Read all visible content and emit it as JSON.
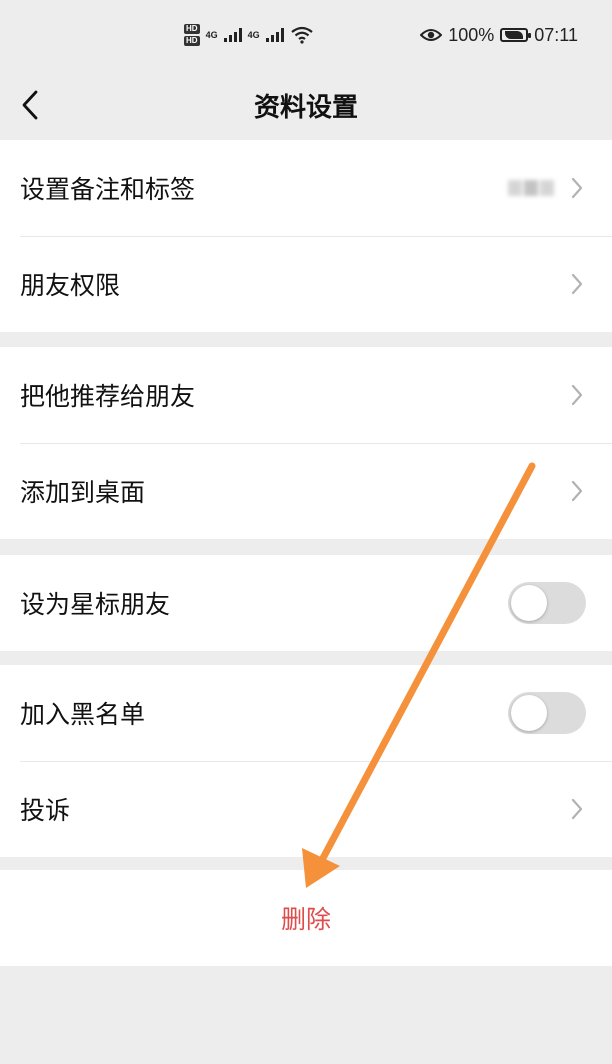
{
  "status_bar": {
    "hd1": "HD",
    "hd2": "HD",
    "net1": "4G",
    "net2": "4G",
    "battery": "100%",
    "time": "07:11"
  },
  "header": {
    "title": "资料设置"
  },
  "groups": [
    [
      {
        "label": "设置备注和标签",
        "control": "chevron",
        "note_blurred": true
      },
      {
        "label": "朋友权限",
        "control": "chevron"
      }
    ],
    [
      {
        "label": "把他推荐给朋友",
        "control": "chevron"
      },
      {
        "label": "添加到桌面",
        "control": "chevron"
      }
    ],
    [
      {
        "label": "设为星标朋友",
        "control": "toggle",
        "value": false
      }
    ],
    [
      {
        "label": "加入黑名单",
        "control": "toggle",
        "value": false
      },
      {
        "label": "投诉",
        "control": "chevron"
      }
    ]
  ],
  "delete_label": "删除",
  "colors": {
    "background": "#ededed",
    "delete_text": "#e04c4c",
    "arrow": "#f5913a",
    "toggle_off": "#dcdcdc"
  }
}
